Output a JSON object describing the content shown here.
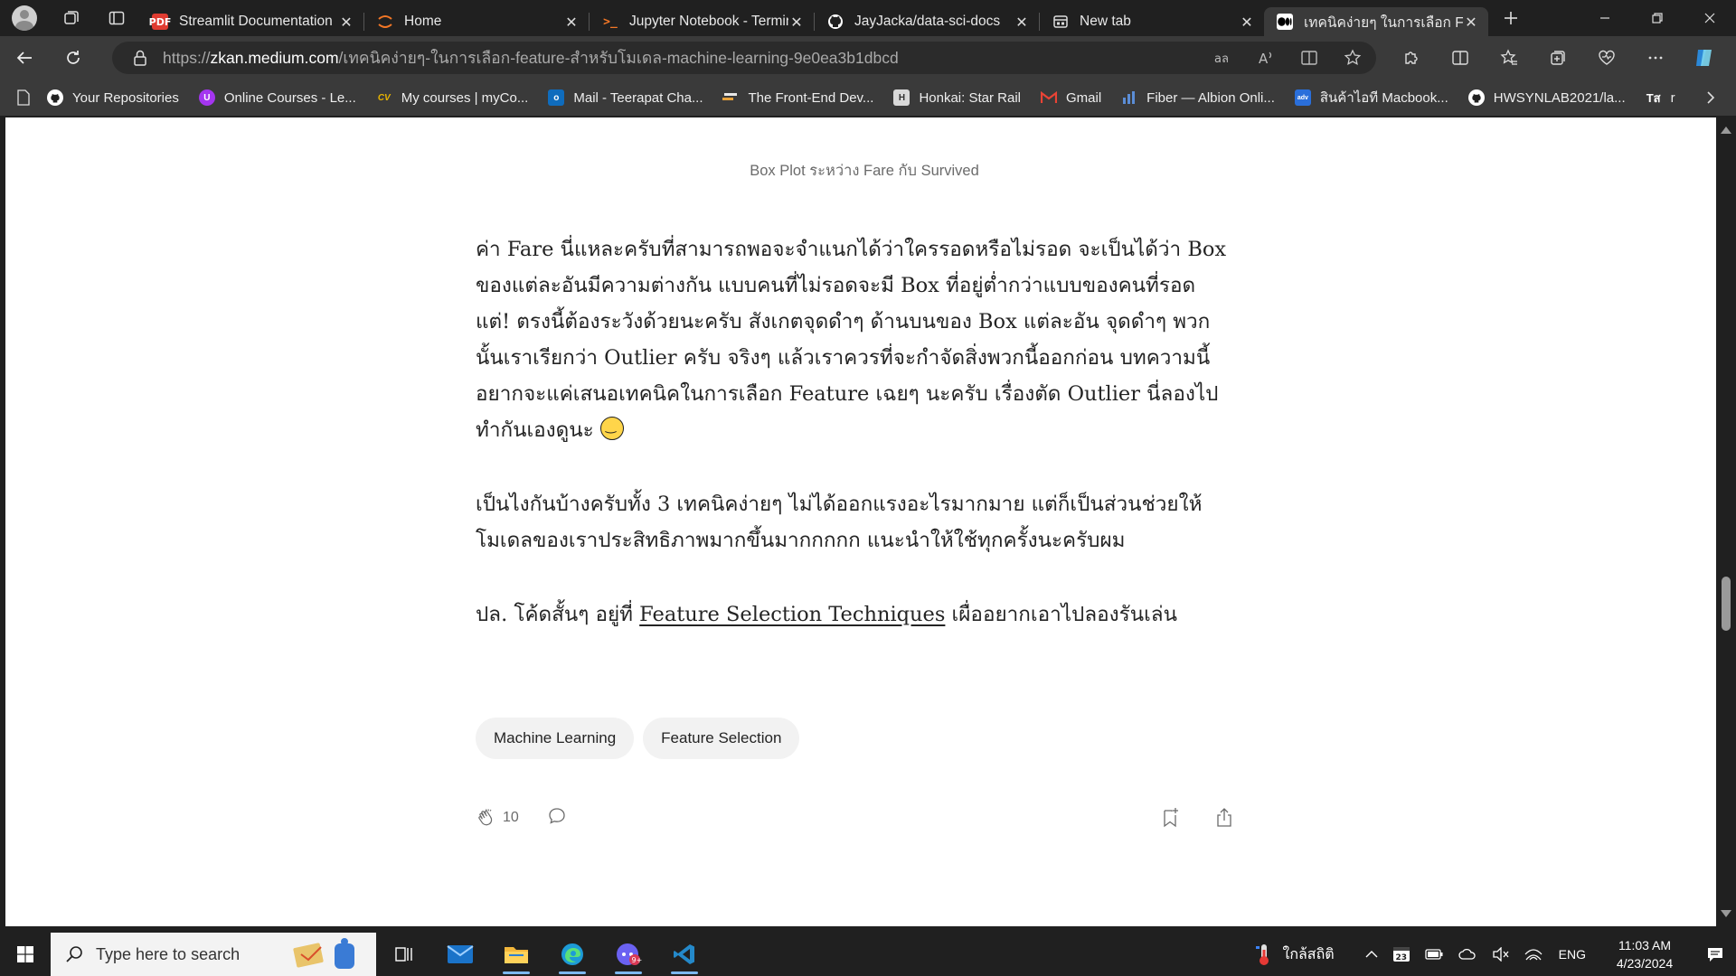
{
  "tabs": [
    {
      "title": "Streamlit Documentation",
      "icon": "pdf-icon",
      "active": false
    },
    {
      "title": "Home",
      "icon": "jupyter-icon",
      "active": false
    },
    {
      "title": "Jupyter Notebook - Terminal",
      "icon": "terminal-icon",
      "active": false
    },
    {
      "title": "JayJacka/data-sci-docs",
      "icon": "github-icon",
      "active": false
    },
    {
      "title": "New tab",
      "icon": "newtab-icon",
      "active": false
    },
    {
      "title": "เทคนิคง่ายๆ ในการเลือก Feature",
      "icon": "medium-icon",
      "active": true
    }
  ],
  "address": {
    "scheme": "https://",
    "host": "zkan.medium.com",
    "path": "/เทคนิคง่ายๆ-ในการเลือก-feature-สำหรับโมเดล-machine-learning-9e0ea3b1dbcd"
  },
  "bookmarks": [
    {
      "label": "Your Repositories",
      "icon": "github-icon",
      "color": "#ffffff"
    },
    {
      "label": "Online Courses - Le...",
      "icon": "udemy-icon",
      "color": "#a435f0"
    },
    {
      "label": "My courses | myCo...",
      "icon": "cv-icon",
      "color": "#e8b400"
    },
    {
      "label": "Mail - Teerapat Cha...",
      "icon": "outlook-icon",
      "color": "#0f6cbd"
    },
    {
      "label": "The Front-End Dev...",
      "icon": "frontend-icon",
      "color": "#e2e2e2"
    },
    {
      "label": "Honkai: Star Rail",
      "icon": "hsr-icon",
      "color": "#d9d9d9"
    },
    {
      "label": "Gmail",
      "icon": "gmail-icon",
      "color": "#ea4335"
    },
    {
      "label": "Fiber — Albion Onli...",
      "icon": "chart-icon",
      "color": "#5b8dd6"
    },
    {
      "label": "สินค้าไอที Macbook...",
      "icon": "advice-icon",
      "color": "#2a6fdb"
    },
    {
      "label": "HWSYNLAB2021/la...",
      "icon": "github-icon",
      "color": "#ffffff"
    },
    {
      "label": "r",
      "icon": "translate-icon",
      "color": "#ffffff"
    }
  ],
  "article": {
    "caption": "Box Plot ระหว่าง Fare กับ Survived",
    "p1": "ค่า Fare นี่แหละครับที่สามารถพอจะจำแนกได้ว่าใครรอดหรือไม่รอด จะเป็นได้ว่า Box ของแต่ละอันมีความต่างกัน แบบคนที่ไม่รอดจะมี Box ที่อยู่ต่ำกว่าแบบของคนที่รอด แต่! ตรงนี้ต้องระวังด้วยนะครับ สังเกตจุดดำๆ ด้านบนของ Box แต่ละอัน จุดดำๆ พวกนั้นเราเรียกว่า Outlier ครับ จริงๆ แล้วเราควรที่จะกำจัดสิ่งพวกนี้ออกก่อน บทความนี้อยากจะแค่เสนอเทคนิคในการเลือก Feature เฉยๆ นะครับ เรื่องตัด Outlier นี่ลองไปทำกันเองดูนะ",
    "p2": "เป็นไงกันบ้างครับทั้ง 3 เทคนิคง่ายๆ ไม่ได้ออกแรงอะไรมากมาย แต่ก็เป็นส่วนช่วยให้โมเดลของเราประสิทธิภาพมากขึ้นมากกกกก แนะนำให้ใช้ทุกครั้งนะครับผม",
    "p3_prefix": "ปล. โค้ดสั้นๆ อยู่ที่ ",
    "p3_link": "Feature Selection Techniques",
    "p3_suffix": " เผื่ออยากเอาไปลองรันเล่น",
    "tags": [
      "Machine Learning",
      "Feature Selection"
    ],
    "claps": "10"
  },
  "taskbar": {
    "search_placeholder": "Type here to search",
    "weather": "ใกล้สถิติ",
    "lang": "ENG",
    "time": "11:03 AM",
    "date": "4/23/2024",
    "badge": "23"
  },
  "colors": {
    "accent": "#3a3a3a",
    "page_text": "#242424",
    "muted": "#6b6b6b",
    "tag_bg": "#f2f2f2"
  }
}
